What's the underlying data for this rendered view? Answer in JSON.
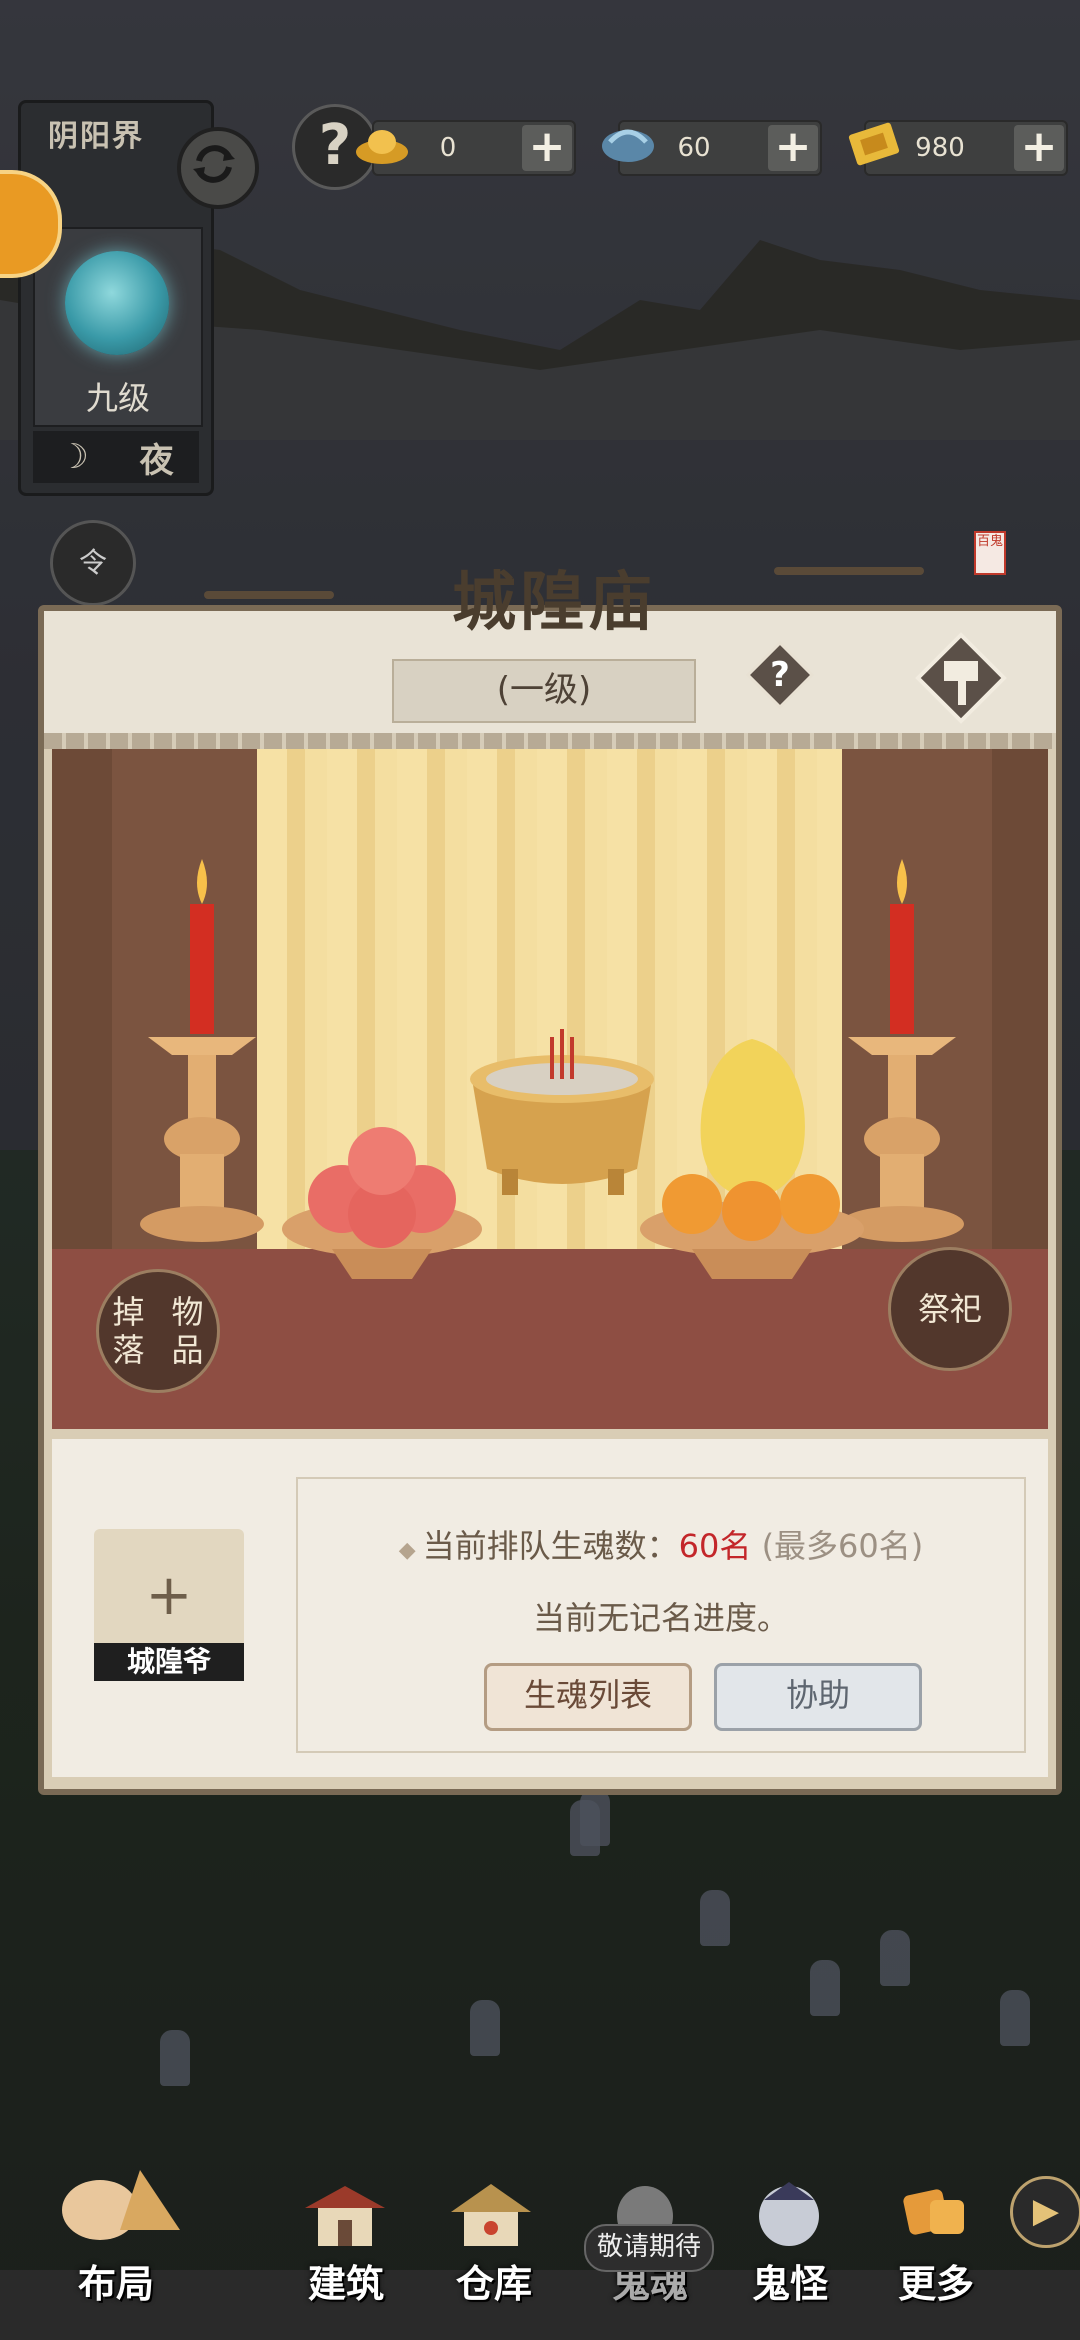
{
  "top_bar": {
    "help_icon": "question-icon",
    "resources": [
      {
        "name": "gold-ingot",
        "icon": "gold-ingot-icon",
        "value": "0"
      },
      {
        "name": "soul-jade",
        "icon": "jade-icon",
        "value": "60"
      },
      {
        "name": "paper-money",
        "icon": "paper-money-icon",
        "value": "980"
      }
    ],
    "plus_label": "+"
  },
  "world_panel": {
    "title": "阴阳界",
    "level": "九级",
    "time_label": "夜"
  },
  "side_quest": {
    "icon_char": "令",
    "label": ""
  },
  "modal": {
    "title": "城隍庙",
    "seal_text": "百鬼",
    "grade": "(一级)",
    "help_char": "?",
    "drop_button": "掉落物品",
    "offer_button": "祭祀",
    "slot": {
      "plus": "+",
      "label": "城隍爷"
    },
    "queue_prefix": "当前排队生魂数：",
    "queue_count": "60名",
    "queue_max": "(最多60名)",
    "progress_text": "当前无记名进度。",
    "btn_list": "生魂列表",
    "btn_help": "协助"
  },
  "bottom_nav": {
    "items": [
      {
        "label": "布局"
      },
      {
        "label": "建筑"
      },
      {
        "label": "仓库"
      },
      {
        "label": "鬼魂"
      },
      {
        "label": "鬼怪"
      },
      {
        "label": "更多"
      }
    ],
    "coming_soon": "敬请期待",
    "next_char": "▶"
  },
  "colors": {
    "accent_red": "#c3262a",
    "panel_bg": "#f1ece3",
    "frame": "#7a6a55"
  }
}
